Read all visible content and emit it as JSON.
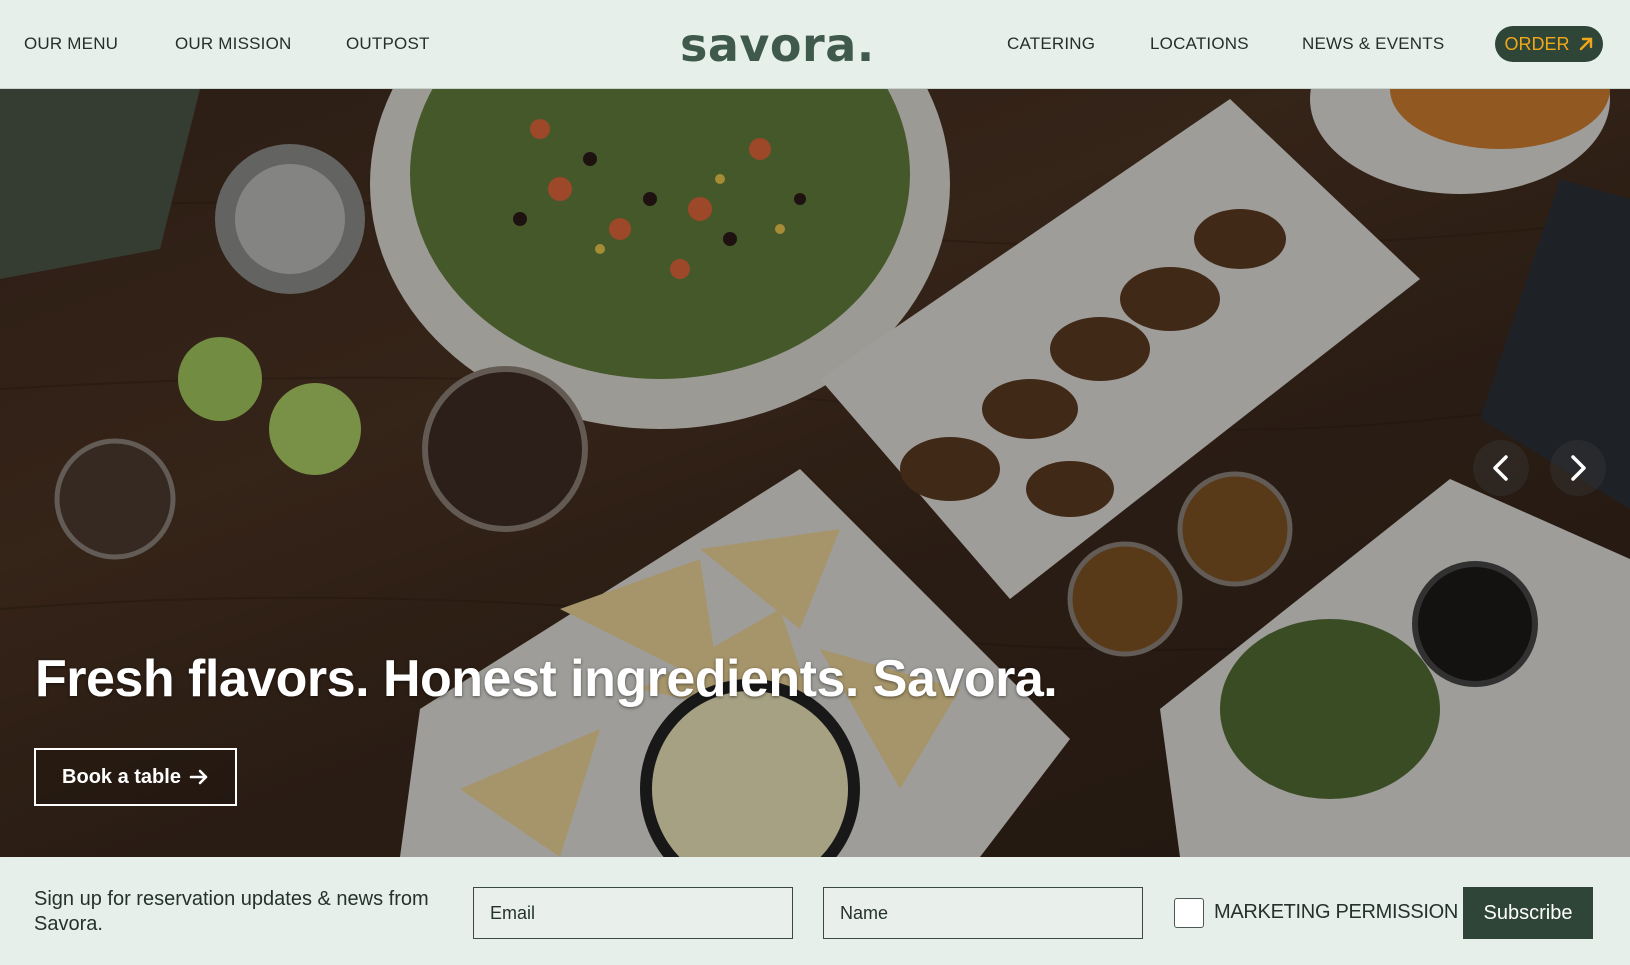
{
  "header": {
    "nav_left": [
      "OUR MENU",
      "OUR MISSION",
      "OUTPOST"
    ],
    "logo": "savora.",
    "nav_right": [
      "CATERING",
      "LOCATIONS",
      "NEWS & EVENTS"
    ],
    "order_label": "ORDER",
    "order_icon": "arrow-up-right-icon"
  },
  "hero": {
    "headline": "Fresh flavors. Honest ingredients. Savora.",
    "book_label": "Book a table",
    "book_icon": "arrow-right-icon",
    "prev_icon": "chevron-left-icon",
    "next_icon": "chevron-right-icon"
  },
  "signup": {
    "text": "Sign up for reservation updates & news from Savora.",
    "email_placeholder": "Email",
    "name_placeholder": "Name",
    "permission_label": "MARKETING PERMISSION",
    "subscribe_label": "Subscribe"
  },
  "colors": {
    "background": "#e7efea",
    "accent_dark": "#2f4538",
    "order_text": "#f0a818",
    "logo": "#3f5a4c"
  }
}
